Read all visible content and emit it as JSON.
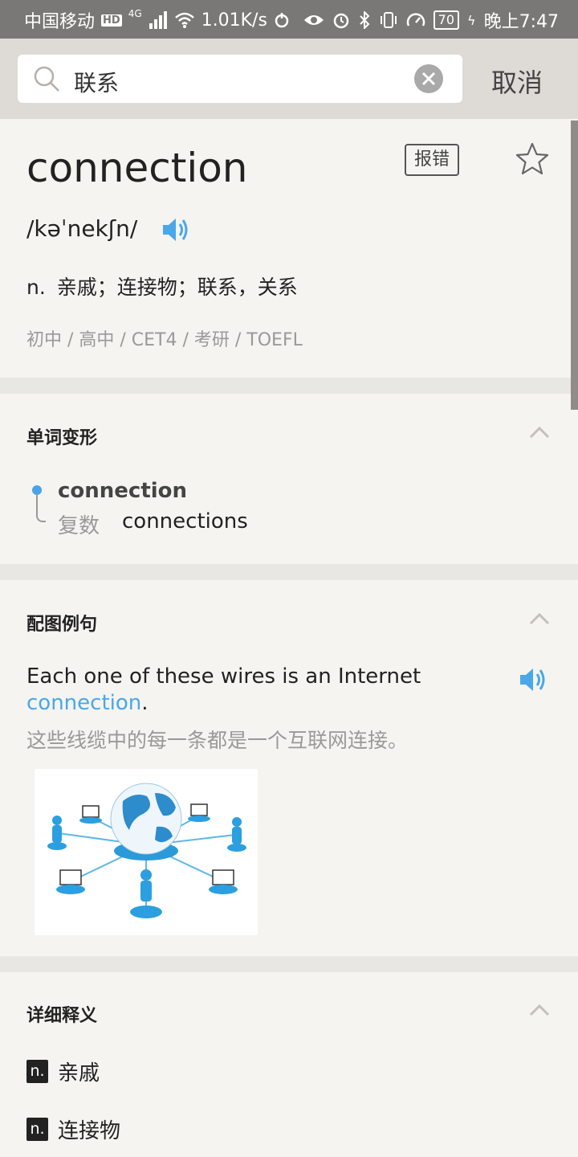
{
  "status_bar": {
    "carrier": "中国移动",
    "hd": "HD",
    "network": "4G",
    "speed": "1.01K/s",
    "battery": "70",
    "time": "晚上7:47"
  },
  "search": {
    "query": "联系",
    "cancel_label": "取消"
  },
  "entry": {
    "word": "connection",
    "report_label": "报错",
    "phonetic": "/kəˈnekʃn/",
    "definition_pos": "n.",
    "definition_text": "亲戚；连接物；联系，关系",
    "levels": "初中 / 高中 / CET4 / 考研 / TOEFL"
  },
  "word_forms": {
    "title": "单词变形",
    "base_word": "connection",
    "plural_label": "复数",
    "plural_value": "connections"
  },
  "illustrated_example": {
    "title": "配图例句",
    "sentence_before": "Each one of these wires is an Internet ",
    "sentence_highlight": "connection",
    "sentence_after": ".",
    "translation": "这些线缆中的每一条都是一个互联网连接。"
  },
  "detailed_definitions": {
    "title": "详细释义",
    "items": [
      {
        "pos": "n.",
        "text": "亲戚"
      },
      {
        "pos": "n.",
        "text": "连接物"
      }
    ]
  },
  "colors": {
    "accent_blue": "#4aa8e8",
    "status_bar": "#7a7876",
    "search_bar": "#dedad6",
    "background": "#f5f4f0"
  }
}
